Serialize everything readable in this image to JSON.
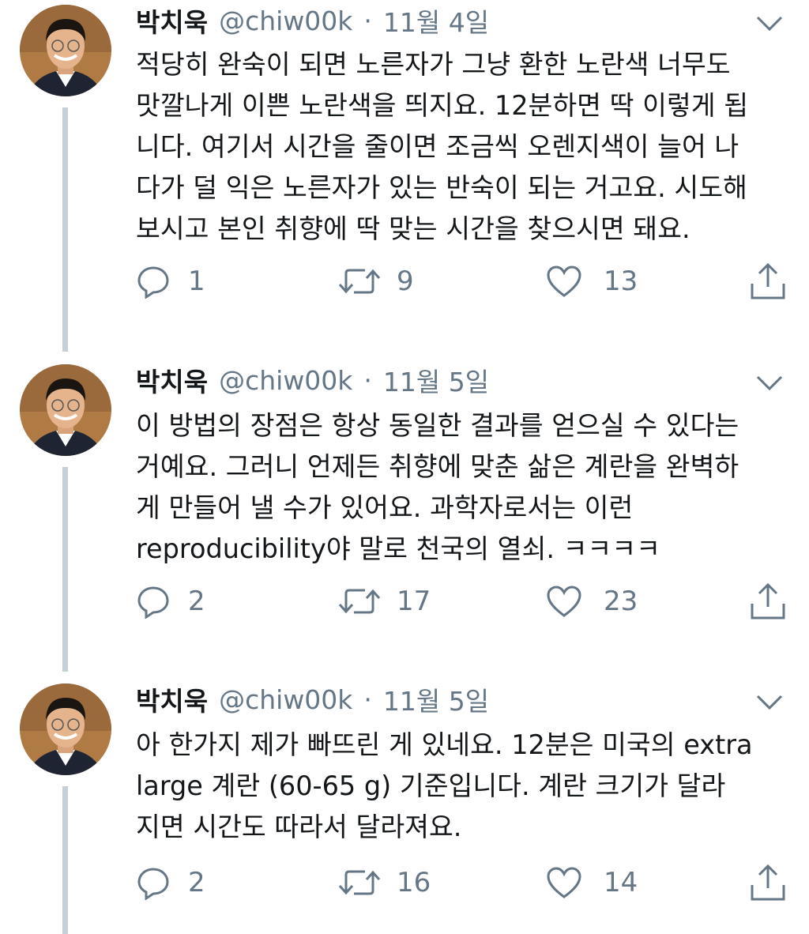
{
  "tweets": [
    {
      "name": "박치욱",
      "handle": "@chiw00k",
      "separator": "·",
      "date": "11월 4일",
      "lines": [
        "적당히 완숙이 되면 노른자가 그냥 환한 노란색 너무도",
        "맛깔나게 이쁜 노란색을 띄지요. 12분하면 딱 이렇게 됩",
        "니다. 여기서 시간을 줄이면 조금씩 오렌지색이 늘어 나",
        "다가 덜 익은 노른자가 있는 반숙이 되는 거고요. 시도해",
        "보시고 본인 취향에 딱 맞는 시간을 찾으시면 돼요."
      ],
      "replies": "1",
      "retweets": "9",
      "likes": "13"
    },
    {
      "name": "박치욱",
      "handle": "@chiw00k",
      "separator": "·",
      "date": "11월 5일",
      "lines": [
        "이 방법의 장점은 항상 동일한 결과를 얻으실 수 있다는",
        "거예요. 그러니 언제든 취향에 맞춘 삶은 계란을 완벽하",
        "게 만들어 낼 수가 있어요. 과학자로서는 이런",
        "reproducibility야 말로 천국의 열쇠. ㅋㅋㅋㅋ"
      ],
      "replies": "2",
      "retweets": "17",
      "likes": "23"
    },
    {
      "name": "박치욱",
      "handle": "@chiw00k",
      "separator": "·",
      "date": "11월 5일",
      "lines": [
        "아 한가지 제가 빠뜨린 게 있네요. 12분은 미국의 extra",
        "large 계란 (60-65 g) 기준입니다. 계란 크기가 달라",
        "지면 시간도 따라서 달라져요."
      ],
      "replies": "2",
      "retweets": "16",
      "likes": "14"
    }
  ],
  "icons": {
    "reply": "reply-icon",
    "retweet": "retweet-icon",
    "like": "heart-icon",
    "share": "share-icon",
    "menu": "chevron-down-icon"
  },
  "colors": {
    "text": "#14171a",
    "secondary": "#657786",
    "thread_line": "#c4cfd6"
  }
}
